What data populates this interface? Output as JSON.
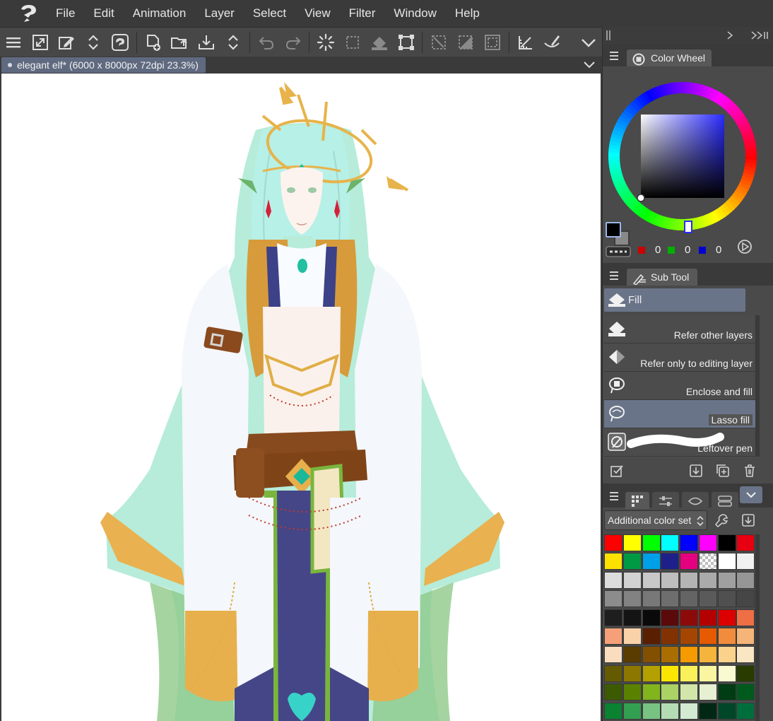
{
  "menubar": {
    "items": [
      "File",
      "Edit",
      "Animation",
      "Layer",
      "Select",
      "View",
      "Filter",
      "Window",
      "Help"
    ]
  },
  "command_bar": {
    "icons": [
      "menu-icon",
      "fit-canvas-icon",
      "edit-icon",
      "sort-icon",
      "app-icon",
      "new-file-icon",
      "open-folder-icon",
      "save-icon",
      "sort-icon",
      "undo-icon",
      "redo-icon",
      "loading-spinner-icon",
      "selection-icon",
      "fill-icon",
      "transform-icon",
      "deselect-icon",
      "invert-selection-icon",
      "select-all-icon",
      "ruler-icon",
      "brush-icon",
      "chevron-down-icon"
    ]
  },
  "document": {
    "tab_title": "elegant elf* (6000 x 8000px 72dpi 23.3%)"
  },
  "color_wheel": {
    "panel_title": "Color Wheel",
    "r_value": "0",
    "g_value": "0",
    "b_value": "0",
    "main_color": "#000000",
    "sub_color": "#888888"
  },
  "sub_tool": {
    "panel_title": "Sub Tool",
    "group_label": "Fill",
    "items": [
      "Refer other layers",
      "Refer only to editing layer",
      "Enclose and fill",
      "Lasso fill",
      "Leftover pen"
    ],
    "selected_index": 3
  },
  "color_set": {
    "selector_label": "Additional color set",
    "swatches": [
      [
        "#ff0000",
        "#ffff00",
        "#00ff00",
        "#00ffff",
        "#0000ff",
        "#ff00ff",
        "#000000",
        "#e60012"
      ],
      [
        "#ffe100",
        "#009944",
        "#00a0e9",
        "#1d2088",
        "#e4007f",
        "transparent",
        "#ffffff",
        "#f0f0f0"
      ],
      [
        "#dcdcdc",
        "#d2d2d2",
        "#c8c8c8",
        "#bebebe",
        "#b4b4b4",
        "#aaaaaa",
        "#a0a0a0",
        "#969696"
      ],
      [
        "#8c8c8c",
        "#828282",
        "#787878",
        "#6e6e6e",
        "#646464",
        "#5a5a5a",
        "#505050",
        "#464646"
      ],
      [
        "#1e1e1e",
        "#141414",
        "#0a0a0a",
        "#5a0a0a",
        "#8c0a0a",
        "#b40000",
        "#dc0000",
        "#ee6e46"
      ],
      [
        "#f5a078",
        "#fad2aa",
        "#5a1e00",
        "#823200",
        "#a54600",
        "#e65a00",
        "#f08c3c",
        "#f5b478"
      ],
      [
        "#fadcbe",
        "#5a3c00",
        "#825000",
        "#aa6e00",
        "#f59a00",
        "#f5b43c",
        "#fad28c",
        "#fae6c3"
      ],
      [
        "#645a00",
        "#8c7800",
        "#b4a000",
        "#fae600",
        "#faf05a",
        "#faf5a0",
        "#fafad2",
        "#283c00"
      ],
      [
        "#3c5a00",
        "#5a8200",
        "#82b41e",
        "#aad264",
        "#d2e6aa",
        "#e6f0d2",
        "#003c14",
        "#005a1e"
      ],
      [
        "#0a8232",
        "#32a050",
        "#78c382",
        "#b4dcb4",
        "#d2ebd2",
        "#002814",
        "#004628",
        "#006e3c"
      ]
    ]
  }
}
